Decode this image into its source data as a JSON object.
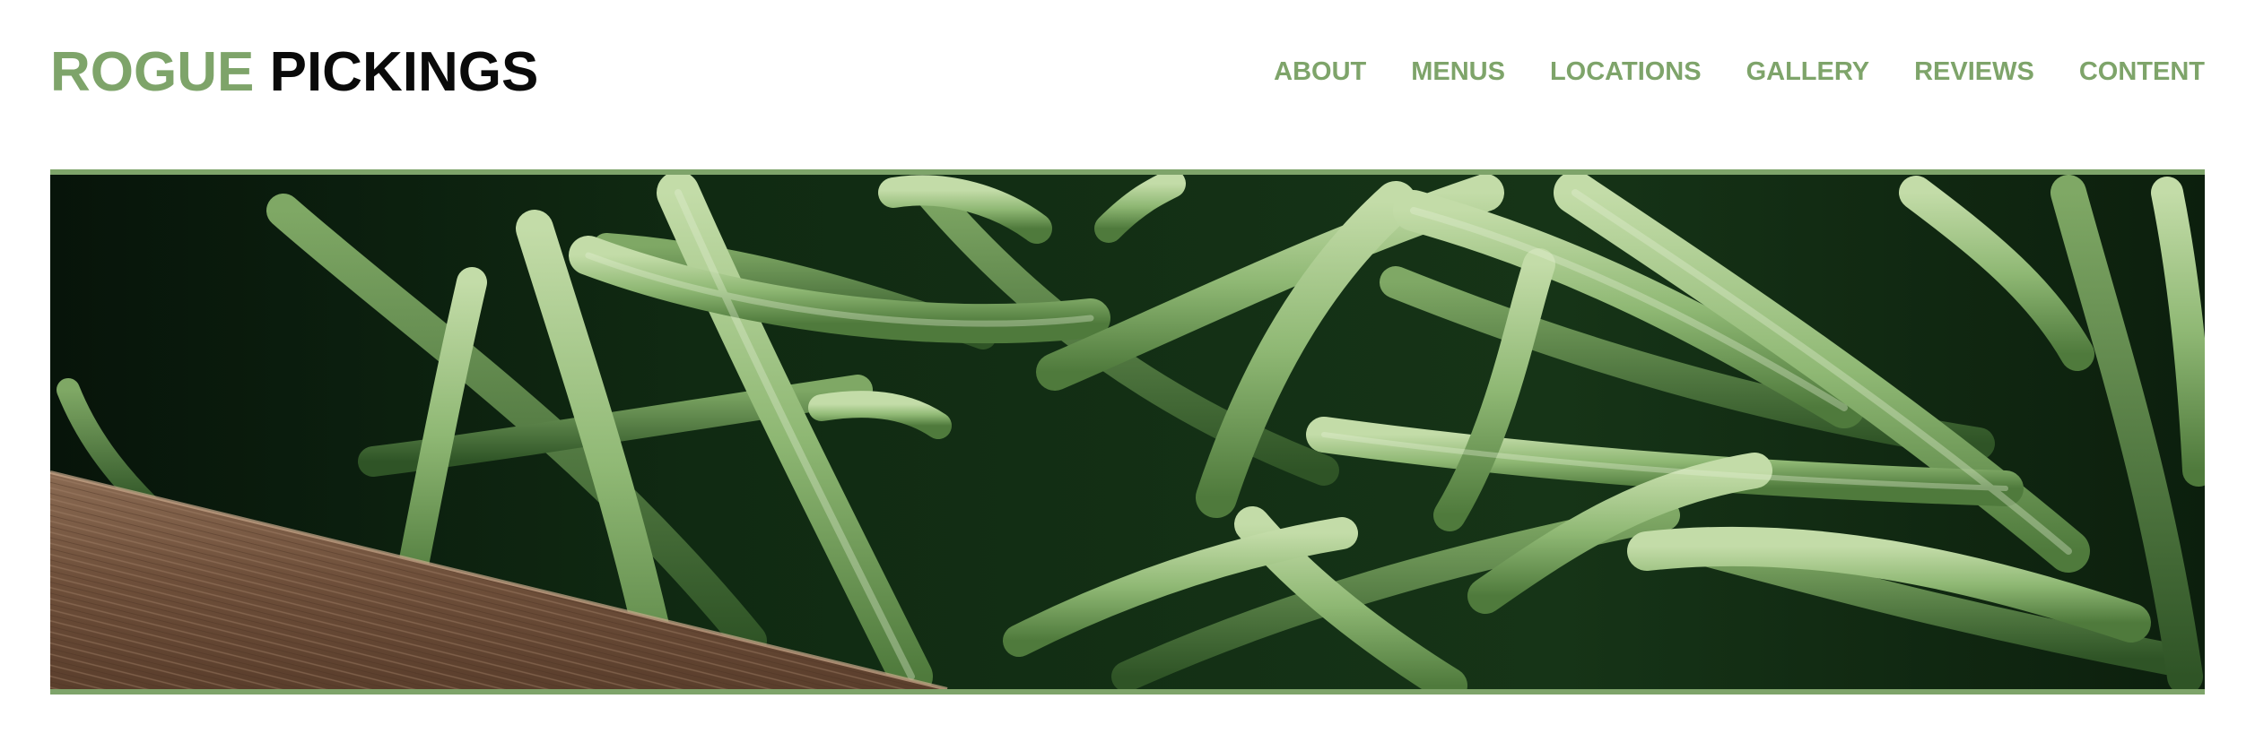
{
  "brand": {
    "word1": "ROGUE",
    "word2": "PICKINGS",
    "accent_color": "#7ea46a",
    "dark_color": "#0a0a0a"
  },
  "nav": {
    "items": [
      "ABOUT",
      "MENUS",
      "LOCATIONS",
      "GALLERY",
      "REVIEWS",
      "CONTENT"
    ]
  },
  "hero": {
    "subject": "green beans in wooden crate",
    "border_color": "#7ea46a"
  }
}
